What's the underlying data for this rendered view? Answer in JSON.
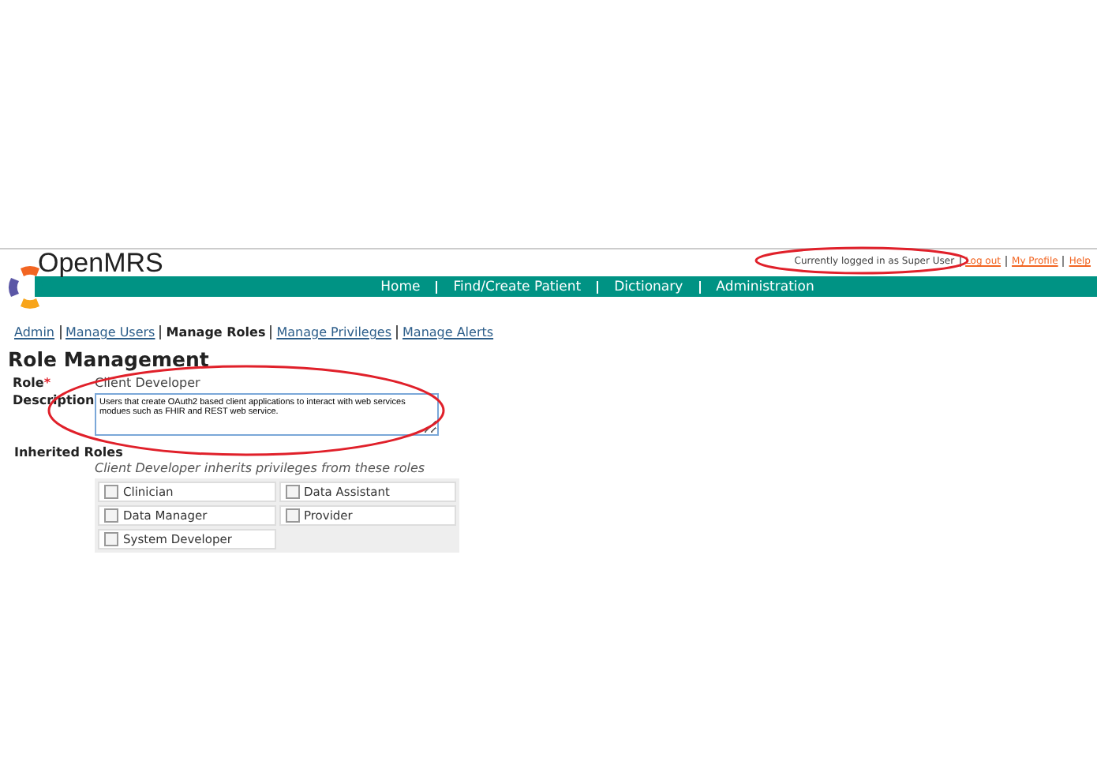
{
  "header": {
    "app_name": "OpenMRS",
    "user_status": "Currently logged in as Super User",
    "user_links": [
      "Log out",
      "My Profile",
      "Help"
    ]
  },
  "nav": [
    "Home",
    "Find/Create Patient",
    "Dictionary",
    "Administration"
  ],
  "breadcrumbs": [
    {
      "label": "Admin",
      "selected": false
    },
    {
      "label": "Manage Users",
      "selected": false
    },
    {
      "label": "Manage Roles",
      "selected": true
    },
    {
      "label": "Manage Privileges",
      "selected": false
    },
    {
      "label": "Manage Alerts",
      "selected": false
    }
  ],
  "page_title": "Role Management",
  "form": {
    "role_label": "Role",
    "required_mark": "*",
    "role_value": "Client Developer",
    "description_label": "Description",
    "description_value": "Users that create OAuth2 based client applications to interact with web services modues such as FHIR and REST web service.",
    "inherited_label": "Inherited Roles",
    "inherited_hint": "Client Developer inherits privileges from these roles",
    "roles": [
      {
        "label": "Clinician",
        "checked": false
      },
      {
        "label": "Data Assistant",
        "checked": false
      },
      {
        "label": "Data Manager",
        "checked": false
      },
      {
        "label": "Provider",
        "checked": false
      },
      {
        "label": "System Developer",
        "checked": false
      }
    ]
  }
}
